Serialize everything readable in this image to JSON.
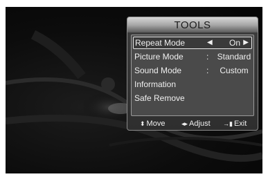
{
  "menu": {
    "title": "TOOLS",
    "items": [
      {
        "label": "Repeat Mode",
        "value": "On",
        "selected": true
      },
      {
        "label": "Picture Mode",
        "value": "Standard"
      },
      {
        "label": "Sound Mode",
        "value": "Custom"
      },
      {
        "label": "Information"
      },
      {
        "label": "Safe Remove"
      }
    ],
    "separator": ":",
    "arrow_left": "◀",
    "arrow_right": "▶"
  },
  "footer": {
    "move_icon": "⬍",
    "move_label": "Move",
    "adjust_icon": "◂▸",
    "adjust_label": "Adjust",
    "exit_icon": "→▮",
    "exit_label": "Exit"
  }
}
